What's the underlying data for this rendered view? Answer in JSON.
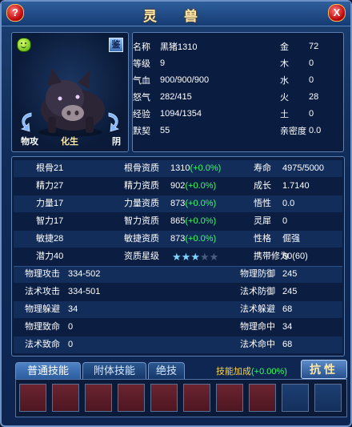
{
  "window": {
    "title": "灵 兽",
    "help_label": "?",
    "close_label": "X"
  },
  "pet_view": {
    "mood_icon": "smiley-icon",
    "identify_label": "鉴",
    "attack_label": "物攻",
    "breed_label": "化生",
    "shade_label": "阴"
  },
  "info": {
    "rows": [
      {
        "l1": "名称",
        "v1": "黑猪1310",
        "l2": "金",
        "v2": "72"
      },
      {
        "l1": "等级",
        "v1": "9",
        "l2": "木",
        "v2": "0"
      },
      {
        "l1": "气血",
        "v1": "900/900/900",
        "l2": "水",
        "v2": "0"
      },
      {
        "l1": "怒气",
        "v1": "282/415",
        "l2": "火",
        "v2": "28"
      },
      {
        "l1": "经验",
        "v1": "1094/1354",
        "l2": "土",
        "v2": "0"
      },
      {
        "l1": "默契",
        "v1": "55",
        "l2": "亲密度",
        "v2": "0.0"
      }
    ]
  },
  "stats": {
    "rows": [
      {
        "a": "根骨",
        "av": "21",
        "b": "根骨资质",
        "bv": "1310",
        "bd": "(+0.0%)",
        "c": "寿命",
        "cv": "4975/5000"
      },
      {
        "a": "精力",
        "av": "27",
        "b": "精力资质",
        "bv": "902",
        "bd": "(+0.0%)",
        "c": "成长",
        "cv": "1.7140"
      },
      {
        "a": "力量",
        "av": "17",
        "b": "力量资质",
        "bv": "873",
        "bd": "(+0.0%)",
        "c": "悟性",
        "cv": "0.0"
      },
      {
        "a": "智力",
        "av": "17",
        "b": "智力资质",
        "bv": "865",
        "bd": "(+0.0%)",
        "c": "灵犀",
        "cv": "0"
      },
      {
        "a": "敏捷",
        "av": "28",
        "b": "敏捷资质",
        "bv": "873",
        "bd": "(+0.0%)",
        "c": "性格",
        "cv": "倔强"
      },
      {
        "a": "潜力",
        "av": "40",
        "b": "资质星级",
        "stars": 3,
        "stars_max": 5,
        "c": "携带修为",
        "cv": "60(60)"
      }
    ],
    "combat": [
      {
        "l1": "物理攻击",
        "v1": "334-502",
        "l2": "物理防御",
        "v2": "245"
      },
      {
        "l1": "法术攻击",
        "v1": "334-501",
        "l2": "法术防御",
        "v2": "245"
      },
      {
        "l1": "物理躲避",
        "v1": "34",
        "l2": "法术躲避",
        "v2": "68"
      },
      {
        "l1": "物理致命",
        "v1": "0",
        "l2": "物理命中",
        "v2": "34"
      },
      {
        "l1": "法术致命",
        "v1": "0",
        "l2": "法术命中",
        "v2": "68"
      }
    ]
  },
  "tabs": [
    {
      "label": "普通技能",
      "active": true
    },
    {
      "label": "附体技能",
      "active": false
    },
    {
      "label": "绝技",
      "active": false
    }
  ],
  "skill_bonus": {
    "label": "技能加成",
    "value": "(+0.00%)"
  },
  "resist_button": "抗性",
  "slots": {
    "red_count": 8,
    "blue_count": 2
  },
  "colors": {
    "accent_green": "#33ff66",
    "bonus_yellow": "#ffd54a",
    "title_gold": "#ffe9a8"
  }
}
